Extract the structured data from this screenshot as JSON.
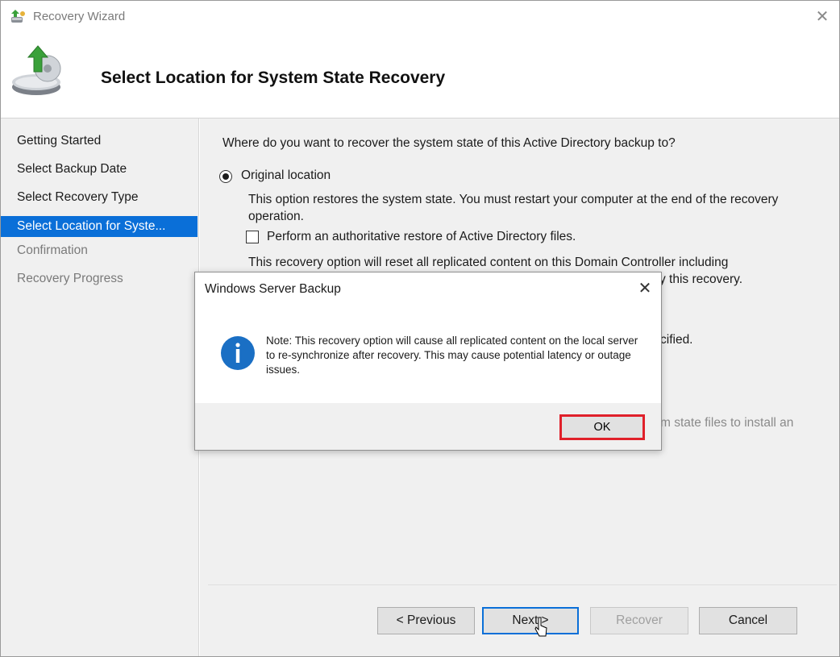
{
  "window": {
    "title": "Recovery Wizard",
    "close_glyph": "✕",
    "icon": "wizard-app-icon"
  },
  "header": {
    "title": "Select Location for System State Recovery",
    "icon": "disk-recovery-icon"
  },
  "sidebar": {
    "items": [
      {
        "label": "Getting Started",
        "state": "normal"
      },
      {
        "label": "Select Backup Date",
        "state": "normal"
      },
      {
        "label": "Select Recovery Type",
        "state": "normal"
      },
      {
        "label": "Select Location for Syste...",
        "state": "active"
      },
      {
        "label": "Confirmation",
        "state": "disabled"
      },
      {
        "label": "Recovery Progress",
        "state": "disabled"
      }
    ]
  },
  "main": {
    "question": "Where do you want to recover the system state of this Active Directory backup to?",
    "radio_original_label": "Original location",
    "radio_original_checked": true,
    "original_desc": "This option restores the system state. You must restart your computer at the end of the recovery operation.",
    "authoritative_label": "Perform an authoritative restore of Active Directory files.",
    "authoritative_checked": false,
    "recovery_desc_line1": "This recovery option will reset all replicated content on this Domain Controller including",
    "recovery_desc_frag": "y this recovery.",
    "frag_cified": "cified.",
    "frag_install": "m state files to install an"
  },
  "buttons": {
    "previous": "< Previous",
    "next": "Next >",
    "recover": "Recover",
    "cancel": "Cancel"
  },
  "dialog": {
    "title": "Windows Server Backup",
    "close_glyph": "✕",
    "message": "Note: This recovery option will cause all replicated content on the local server to re-synchronize after recovery. This may cause potential latency or outage issues.",
    "ok": "OK",
    "icon": "info-icon"
  },
  "colors": {
    "accent": "#0a6fd8",
    "highlight": "#e0202a",
    "info_icon": "#1a6fc4"
  }
}
